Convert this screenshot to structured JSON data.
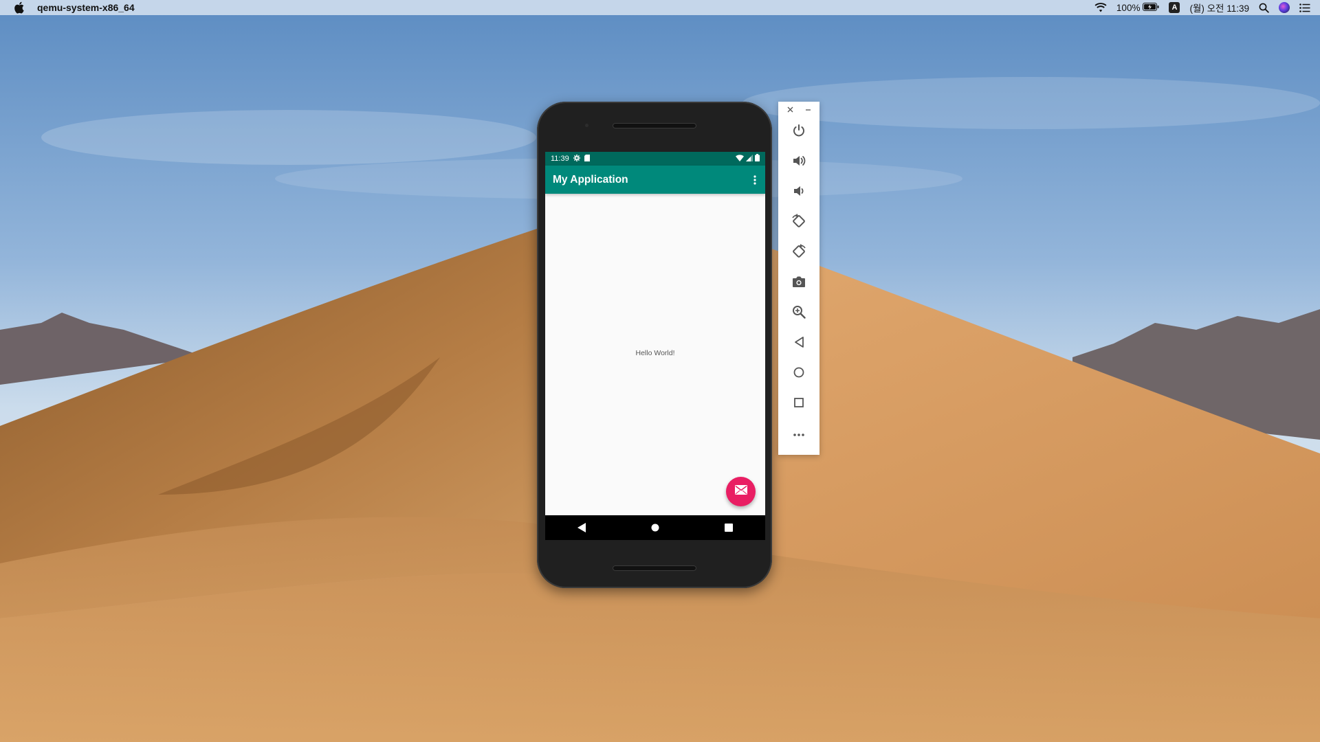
{
  "menubar": {
    "app_name": "qemu-system-x86_64",
    "battery": "100%",
    "input_method": "A",
    "clock": "(월) 오전 11:39"
  },
  "android": {
    "status_time": "11:39",
    "app_title": "My Application",
    "hello_text": "Hello World!",
    "colors": {
      "status_bar": "#00695c",
      "app_bar": "#00897b",
      "fab": "#e91e63"
    }
  },
  "toolbar": {
    "buttons": [
      "power-icon",
      "volume-up-icon",
      "volume-down-icon",
      "rotate-left-icon",
      "rotate-right-icon",
      "camera-icon",
      "zoom-icon",
      "back-icon",
      "home-icon",
      "overview-icon",
      "more-icon"
    ]
  }
}
